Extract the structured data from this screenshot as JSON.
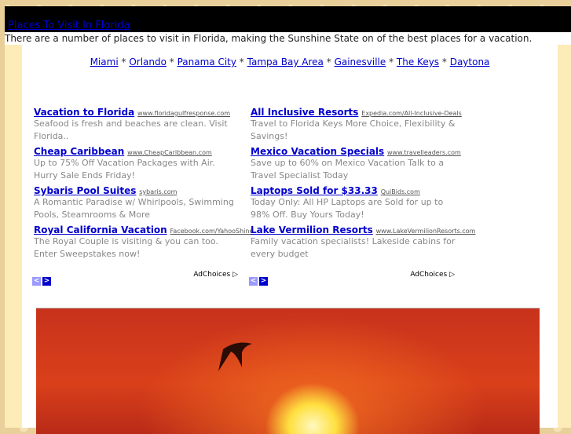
{
  "header": {
    "title": "Places To Visit In Florida"
  },
  "intro": "There are a number of places to visit in Florida, making the Sunshine State on of the best places for a vacation.",
  "nav": {
    "links": [
      "Miami",
      "Orlando",
      "Panama City",
      "Tampa Bay Area",
      "Gainesville",
      "The Keys",
      "Daytona"
    ],
    "separator": " * "
  },
  "ads": [
    {
      "items": [
        {
          "title": "Vacation to Florida",
          "url": "www.floridagulfresponse.com",
          "desc": "Seafood is fresh and beaches are clean. Visit Florida.."
        },
        {
          "title": "Cheap Caribbean",
          "url": "www.CheapCaribbean.com",
          "desc": "Up to 75% Off Vacation Packages with Air. Hurry Sale Ends Friday!"
        },
        {
          "title": "Sybaris Pool Suites",
          "url": "sybaris.com",
          "desc": "A Romantic Paradise w/ Whirlpools, Swimming Pools, Steamrooms & More"
        },
        {
          "title": "Royal California Vacation",
          "url": "Facebook.com/YahooShine",
          "desc": "The Royal Couple is visiting & you can too. Enter Sweepstakes now!"
        }
      ],
      "adchoices": "AdChoices"
    },
    {
      "items": [
        {
          "title": "All Inclusive Resorts",
          "url": "Expedia.com/All-Inclusive-Deals",
          "desc": "Travel to Florida Keys More Choice, Flexibility & Savings!"
        },
        {
          "title": "Mexico Vacation Specials",
          "url": "www.travelleaders.com",
          "desc": "Save up to 60% on Mexico Vacation Talk to a Travel Specialist Today"
        },
        {
          "title": "Laptops Sold for $33.33",
          "url": "QuiBids.com",
          "desc": "Today Only: All HP Laptops are Sold for up to 98% Off. Buy Yours Today!"
        },
        {
          "title": "Lake Vermilion Resorts",
          "url": "www.LakeVermilionResorts.com",
          "desc": "Family vacation specialists! Lakeside cabins for every budget"
        }
      ],
      "adchoices": "AdChoices"
    }
  ]
}
